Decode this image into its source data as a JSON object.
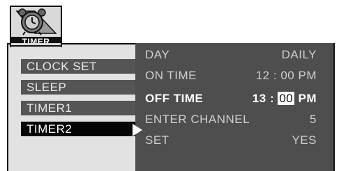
{
  "tab": {
    "label": "TIMER",
    "icon": "alarm-clock-icon"
  },
  "menu": [
    {
      "label": "CLOCK SET"
    },
    {
      "label": "SLEEP"
    },
    {
      "label": "TIMER1"
    },
    {
      "label": "TIMER2"
    }
  ],
  "rows": [
    {
      "label": "DAY",
      "value": "DAILY"
    },
    {
      "label": "ON TIME",
      "hour": "12",
      "sep": ":",
      "minute": "00",
      "ampm": "PM"
    },
    {
      "label": "OFF TIME",
      "hour": "13",
      "sep": ":",
      "minute": "00",
      "ampm": "PM"
    },
    {
      "label": "ENTER CHANNEL",
      "value": "5"
    },
    {
      "label": "SET",
      "value": "YES"
    }
  ],
  "colors": {
    "panel": "#4e4e4e",
    "frame": "#e2e2e2",
    "selected": "#050505",
    "menu_item": "#555555"
  }
}
